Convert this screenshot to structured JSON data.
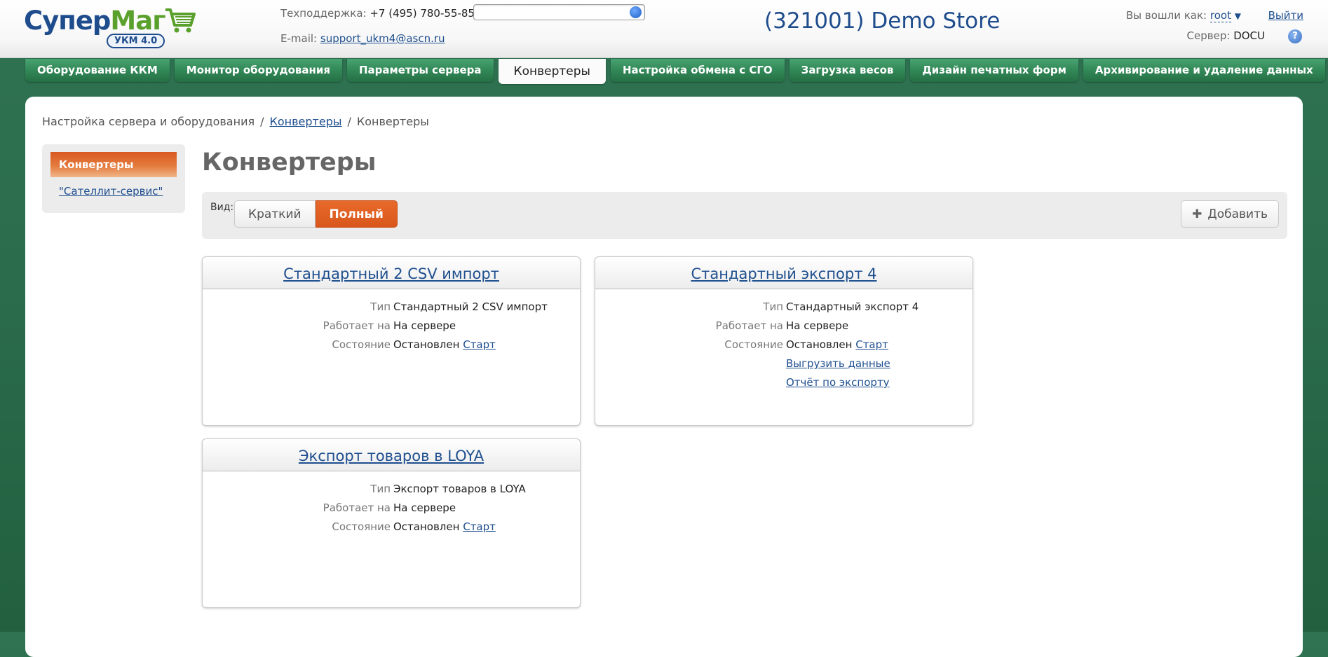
{
  "header": {
    "logo_text_a": "Супер",
    "logo_text_b": "Маг",
    "logo_badge": "УКМ 4.0",
    "support_label": "Техподдержка:",
    "support_phone": "+7 (495) 780-55-85",
    "email_label": "E-mail:",
    "email_value": "support_ukm4@ascn.ru",
    "search_value": "",
    "store_title": "(321001) Demo Store",
    "logged_label": "Вы вошли как:",
    "user_name": "root",
    "logout": "Выйти",
    "server_label": "Сервер:",
    "server_value": "DOCU",
    "help_glyph": "?"
  },
  "tabs": [
    {
      "label": "Оборудование ККМ"
    },
    {
      "label": "Монитор оборудования"
    },
    {
      "label": "Параметры сервера"
    },
    {
      "label": "Конвертеры"
    },
    {
      "label": "Настройка обмена с СГО"
    },
    {
      "label": "Загрузка весов"
    },
    {
      "label": "Дизайн печатных форм"
    },
    {
      "label": "Архивирование и удаление данных"
    }
  ],
  "breadcrumb": {
    "root": "Настройка сервера и оборудования",
    "link": "Конвертеры",
    "current": "Конвертеры",
    "sep": "/"
  },
  "sidebar": {
    "active": "Конвертеры",
    "link": "\"Сателлит-сервис\""
  },
  "page_title": "Конвертеры",
  "toolbar": {
    "view_label": "Вид:",
    "short_label": "Краткий",
    "full_label": "Полный",
    "add_label": "Добавить",
    "add_glyph": "✚"
  },
  "cards": [
    {
      "title": "Стандартный 2 CSV импорт",
      "type_label": "Тип",
      "type_value": "Стандартный 2 CSV импорт",
      "runs_label": "Работает на",
      "runs_value": "На сервере",
      "state_label": "Состояние",
      "state_value": "Остановлен",
      "start_link": "Старт"
    },
    {
      "title": "Стандартный экспорт 4",
      "type_label": "Тип",
      "type_value": "Стандартный экспорт 4",
      "runs_label": "Работает на",
      "runs_value": "На сервере",
      "state_label": "Состояние",
      "state_value": "Остановлен",
      "start_link": "Старт",
      "export_link": "Выгрузить данные",
      "report_link": "Отчёт по экспорту"
    },
    {
      "title": "Экспорт товаров в LOYA",
      "type_label": "Тип",
      "type_value": "Экспорт товаров в LOYA",
      "runs_label": "Работает на",
      "runs_value": "На сервере",
      "state_label": "Состояние",
      "state_value": "Остановлен",
      "start_link": "Старт"
    }
  ],
  "colors": {
    "brand_blue": "#1e4c8c",
    "tab_green": "#328857",
    "accent_orange": "#d9571c"
  }
}
